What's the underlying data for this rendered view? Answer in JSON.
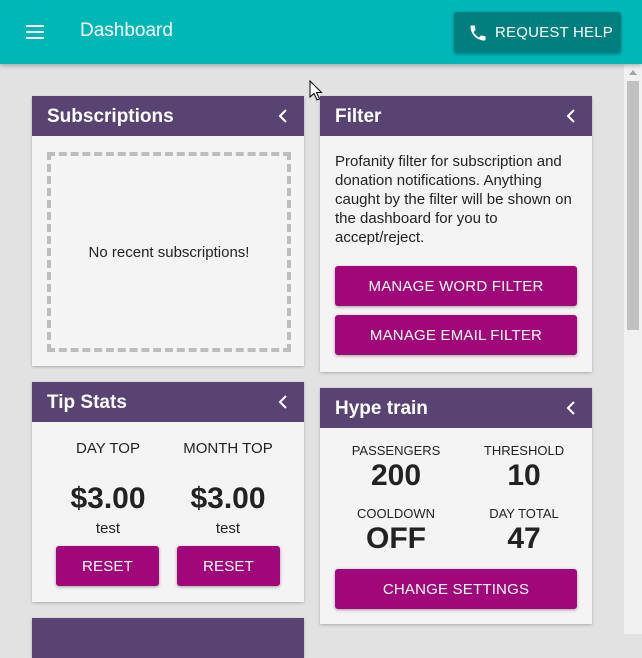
{
  "header": {
    "title": "Dashboard",
    "help_button": "REQUEST HELP",
    "icons": {
      "menu": "hamburger-menu-icon",
      "help": "phone-icon"
    },
    "color": "#00b7b7"
  },
  "subscriptions": {
    "title": "Subscriptions",
    "empty_text": "No recent subscriptions!"
  },
  "filter": {
    "title": "Filter",
    "description": "Profanity filter for subscription and donation notifications. Anything caught by the filter will be shown on the dashboard for you to accept/reject.",
    "word_filter_button": "MANAGE WORD FILTER",
    "email_filter_button": "MANAGE EMAIL FILTER"
  },
  "tip_stats": {
    "title": "Tip Stats",
    "columns": [
      {
        "label": "DAY TOP",
        "amount": "$3.00",
        "name": "test",
        "reset": "RESET"
      },
      {
        "label": "MONTH TOP",
        "amount": "$3.00",
        "name": "test",
        "reset": "RESET"
      }
    ]
  },
  "hype_train": {
    "title": "Hype train",
    "stats": [
      {
        "label": "PASSENGERS",
        "value": "200"
      },
      {
        "label": "THRESHOLD",
        "value": "10"
      },
      {
        "label": "COOLDOWN",
        "value": "OFF"
      },
      {
        "label": "DAY TOTAL",
        "value": "47"
      }
    ],
    "settings_button": "CHANGE SETTINGS"
  },
  "colors": {
    "panel_header": "#584373",
    "action_button": "#a0087a",
    "help_button": "#007f7f"
  }
}
